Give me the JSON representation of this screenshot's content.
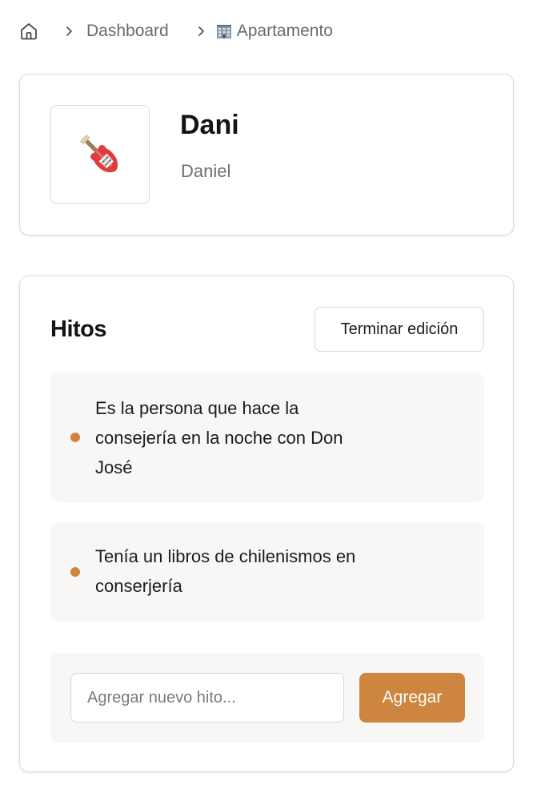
{
  "breadcrumb": {
    "home_icon": "home-icon",
    "separator_icon": "chevron-right-icon",
    "items": [
      {
        "label": "Dashboard"
      },
      {
        "label": "Apartamento",
        "icon": "office-building-emoji"
      }
    ]
  },
  "profile": {
    "avatar_icon": "guitar-emoji",
    "name": "Dani",
    "full_name": "Daniel"
  },
  "milestones": {
    "title": "Hitos",
    "edit_button": "Terminar edición",
    "items": [
      {
        "text": "Es la persona que hace la consejería en la noche con Don José"
      },
      {
        "text": "Tenía un libros de chilenismos en conserjería"
      }
    ],
    "bullet_color": "#cd853f",
    "new_input": {
      "value": "",
      "placeholder": "Agregar nuevo hito..."
    },
    "add_button": "Agregar",
    "accent_color": "#cd853f"
  }
}
